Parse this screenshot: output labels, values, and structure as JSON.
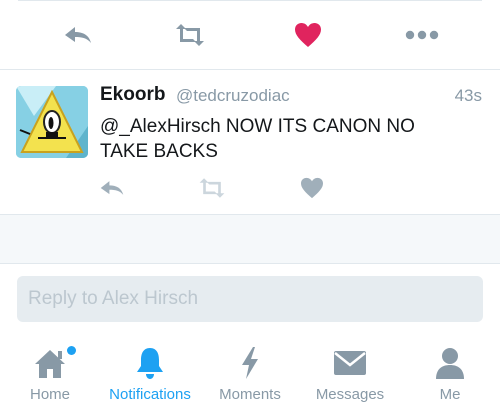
{
  "colors": {
    "like_active": "#e0245e",
    "icon_gray": "#8899a6",
    "icon_light": "#ccd6dd",
    "accent": "#1da1f2"
  },
  "action_bar": {
    "icons": [
      "reply-icon",
      "retweet-icon",
      "heart-icon",
      "more-icon"
    ]
  },
  "tweet": {
    "name": "Ekoorb",
    "handle": "@tedcruzodiac",
    "time": "43s",
    "text": "@_AlexHirsch  NOW ITS CANON NO TAKE BACKS"
  },
  "reply": {
    "placeholder": "Reply to Alex Hirsch"
  },
  "tabs": [
    {
      "label": "Home",
      "icon": "home-icon"
    },
    {
      "label": "Notifications",
      "icon": "bell-icon"
    },
    {
      "label": "Moments",
      "icon": "lightning-icon"
    },
    {
      "label": "Messages",
      "icon": "envelope-icon"
    },
    {
      "label": "Me",
      "icon": "person-icon"
    }
  ]
}
